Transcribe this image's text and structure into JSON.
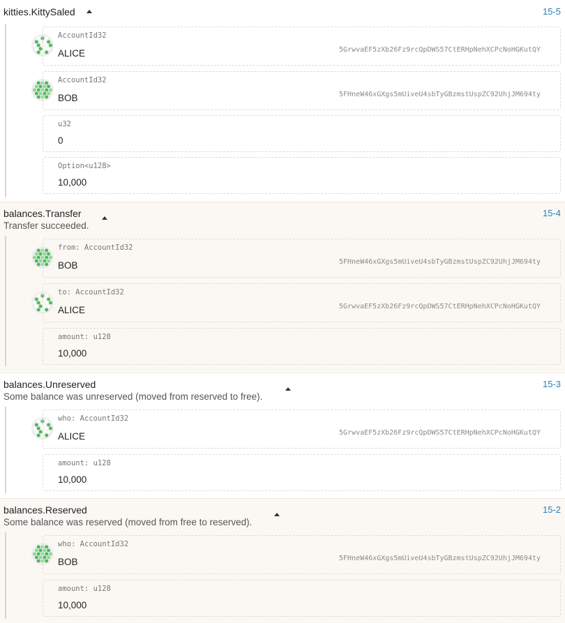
{
  "accent_color": "#2a7fb5",
  "identicon_color": "#4cbb5a",
  "events": [
    {
      "title": "kitties.KittySaled",
      "description": "",
      "id": "15-5",
      "params": [
        {
          "type": "AccountId32",
          "value": "ALICE",
          "address": "5GrwvaEF5zXb26Fz9rcQpDWS57CtERHpNehXCPcNoHGKutQY",
          "icon": "identicon-alice"
        },
        {
          "type": "AccountId32",
          "value": "BOB",
          "address": "5FHneW46xGXgs5mUiveU4sbTyGBzmstUspZC92UhjJM694ty",
          "icon": "identicon-bob"
        },
        {
          "type": "u32",
          "value": "0"
        },
        {
          "type": "Option<u128>",
          "value": "10,000"
        }
      ]
    },
    {
      "title": "balances.Transfer",
      "description": "Transfer succeeded.",
      "id": "15-4",
      "params": [
        {
          "type": "from: AccountId32",
          "value": "BOB",
          "address": "5FHneW46xGXgs5mUiveU4sbTyGBzmstUspZC92UhjJM694ty",
          "icon": "identicon-bob"
        },
        {
          "type": "to: AccountId32",
          "value": "ALICE",
          "address": "5GrwvaEF5zXb26Fz9rcQpDWS57CtERHpNehXCPcNoHGKutQY",
          "icon": "identicon-alice"
        },
        {
          "type": "amount: u128",
          "value": "10,000"
        }
      ]
    },
    {
      "title": "balances.Unreserved",
      "description": "Some balance was unreserved (moved from reserved to free).",
      "id": "15-3",
      "params": [
        {
          "type": "who: AccountId32",
          "value": "ALICE",
          "address": "5GrwvaEF5zXb26Fz9rcQpDWS57CtERHpNehXCPcNoHGKutQY",
          "icon": "identicon-alice"
        },
        {
          "type": "amount: u128",
          "value": "10,000"
        }
      ]
    },
    {
      "title": "balances.Reserved",
      "description": "Some balance was reserved (moved from free to reserved).",
      "id": "15-2",
      "params": [
        {
          "type": "who: AccountId32",
          "value": "BOB",
          "address": "5FHneW46xGXgs5mUiveU4sbTyGBzmstUspZC92UhjJM694ty",
          "icon": "identicon-bob"
        },
        {
          "type": "amount: u128",
          "value": "10,000"
        }
      ]
    }
  ]
}
